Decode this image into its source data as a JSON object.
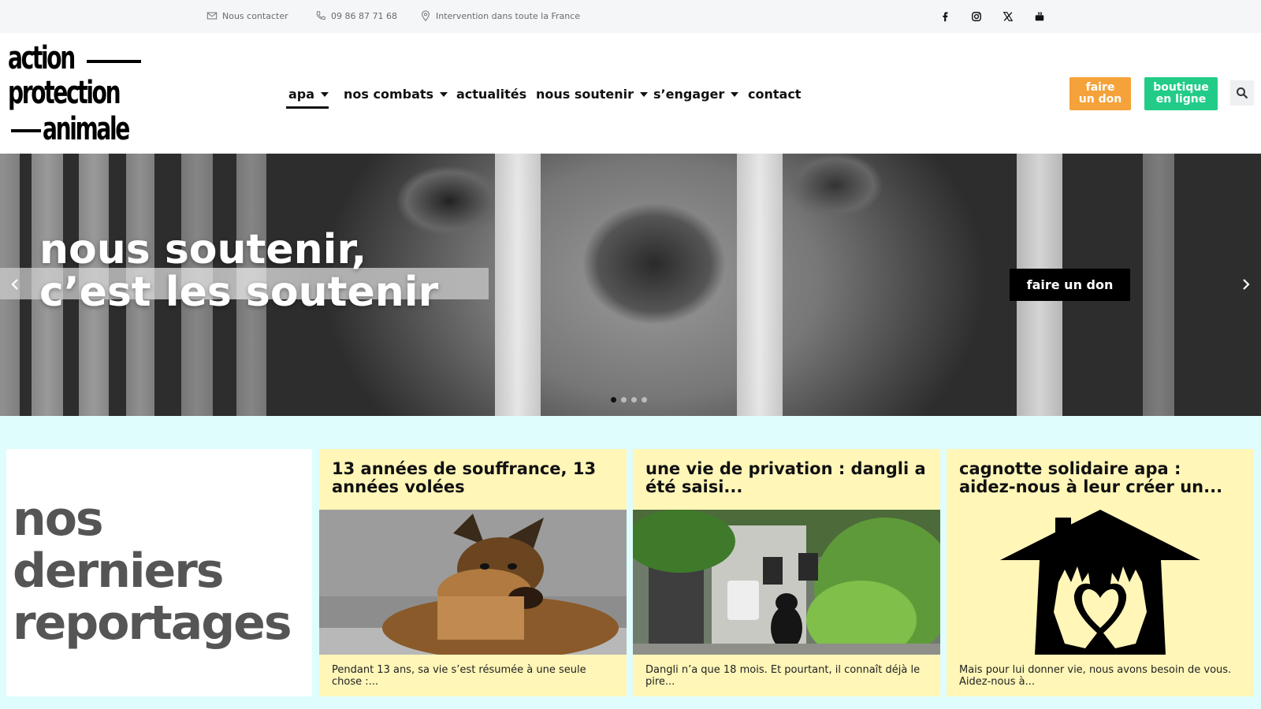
{
  "topbar": {
    "contact_label": "Nous contacter",
    "phone": "09 86 87 71 68",
    "location": "Intervention dans toute la France",
    "social_icons": [
      "facebook-icon",
      "instagram-icon",
      "x-icon",
      "youtube-icon"
    ]
  },
  "logo": {
    "line1": "action",
    "line2": "protection",
    "line3": "animale"
  },
  "nav": {
    "items": [
      {
        "label": "apa",
        "dropdown": true,
        "active": true
      },
      {
        "label": "nos combats",
        "dropdown": true
      },
      {
        "label": "actualités",
        "dropdown": false
      },
      {
        "label": "nous soutenir",
        "dropdown": true
      },
      {
        "label": "s’engager",
        "dropdown": true
      },
      {
        "label": "contact",
        "dropdown": false
      }
    ],
    "don_label_1": "faire",
    "don_label_2": "un don",
    "shop_label_1": "boutique",
    "shop_label_2": "en ligne"
  },
  "hero": {
    "title_line1": "nous soutenir,",
    "title_line2": "c’est les soutenir",
    "cta": "faire un don",
    "slide_count": 4,
    "active_slide": 1
  },
  "reports": {
    "heading_1": "nos",
    "heading_2": "derniers",
    "heading_3": "reportages",
    "cards": [
      {
        "title": "13 années de souffrance, 13 années volées",
        "excerpt": "Pendant 13 ans, sa vie s’est résumée à une seule chose :..."
      },
      {
        "title": "une vie de privation : dangli a été saisi...",
        "excerpt": "Dangli n’a que 18 mois. Et pourtant, il connaît déjà le pire..."
      },
      {
        "title": "cagnotte solidaire apa : aidez-nous à leur créer un...",
        "excerpt": "Mais pour lui donner vie, nous avons besoin de vous. Aidez-nous à..."
      }
    ]
  },
  "colors": {
    "accent_orange": "#f5a23a",
    "accent_green": "#22cc88",
    "card_yellow": "#fff6b8",
    "page_cyan": "#dffdfd"
  }
}
